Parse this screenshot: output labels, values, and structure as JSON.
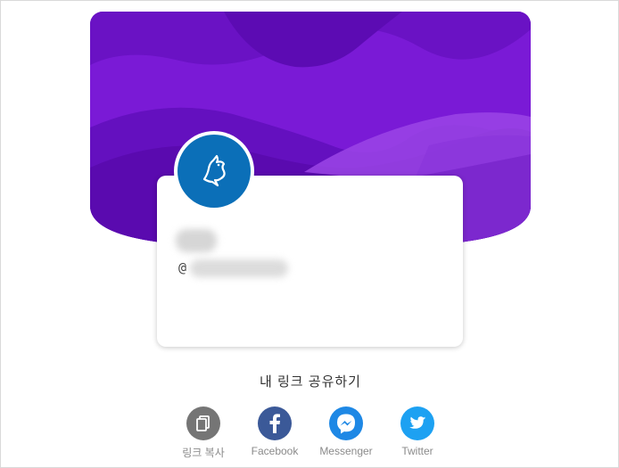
{
  "profile": {
    "handle_prefix": "@",
    "avatar_icon": "bird-icon"
  },
  "share": {
    "title": "내 링크 공유하기",
    "items": [
      {
        "label": "링크 복사",
        "icon": "copy-icon",
        "color": "#757575"
      },
      {
        "label": "Facebook",
        "icon": "facebook-icon",
        "color": "#3b5998"
      },
      {
        "label": "Messenger",
        "icon": "messenger-icon",
        "color": "#1e88e5"
      },
      {
        "label": "Twitter",
        "icon": "twitter-icon",
        "color": "#1da1f2"
      }
    ]
  },
  "colors": {
    "banner_primary": "#7a1fd6",
    "avatar_bg": "#0b6fb8"
  }
}
